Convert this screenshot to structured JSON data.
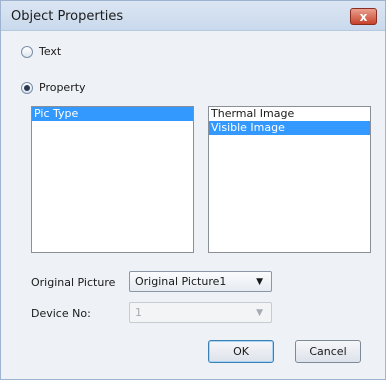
{
  "window": {
    "title": "Object Properties",
    "close_label": "x"
  },
  "radios": {
    "text": {
      "label": "Text",
      "checked": false
    },
    "property": {
      "label": "Property",
      "checked": true
    }
  },
  "left_list": {
    "items": [
      "Pic Type"
    ],
    "selected_index": 0
  },
  "right_list": {
    "items": [
      "Thermal Image",
      "Visible Image"
    ],
    "selected_index": 1
  },
  "fields": {
    "original_picture": {
      "label": "Original Picture",
      "value": "Original Picture1"
    },
    "device_no": {
      "label": "Device No:",
      "value": "1",
      "disabled": true
    }
  },
  "buttons": {
    "ok": "OK",
    "cancel": "Cancel"
  },
  "colors": {
    "selection": "#3399ff",
    "dialog_bg": "#eef1f6",
    "close": "#c7432c"
  }
}
